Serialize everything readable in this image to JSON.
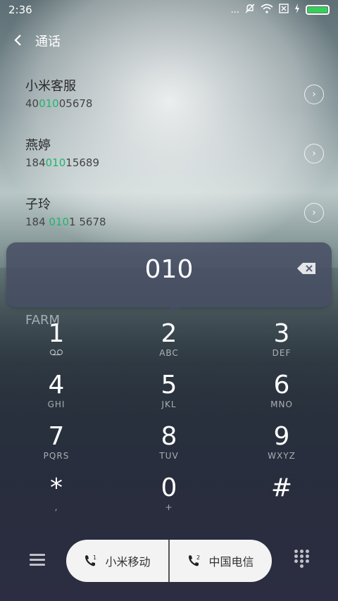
{
  "status": {
    "time": "2:36",
    "dots": "..."
  },
  "header": {
    "title": "通话"
  },
  "contacts": [
    {
      "name": "小米客服",
      "num_pre": "40",
      "num_hl": "010",
      "num_post": "05678"
    },
    {
      "name": "燕婷",
      "num_pre": "184",
      "num_hl": "010",
      "num_post": "15689"
    },
    {
      "name": "子玲",
      "num_pre": "184 ",
      "num_hl": "010",
      "num_post": "1 5678"
    }
  ],
  "dial": {
    "number": "010"
  },
  "peek_text": "FARM",
  "keypad": [
    {
      "digit": "1",
      "sub": "⁣"
    },
    {
      "digit": "2",
      "sub": "ABC"
    },
    {
      "digit": "3",
      "sub": "DEF"
    },
    {
      "digit": "4",
      "sub": "GHI"
    },
    {
      "digit": "5",
      "sub": "JKL"
    },
    {
      "digit": "6",
      "sub": "MNO"
    },
    {
      "digit": "7",
      "sub": "PQRS"
    },
    {
      "digit": "8",
      "sub": "TUV"
    },
    {
      "digit": "9",
      "sub": "WXYZ"
    },
    {
      "digit": "*",
      "sub": ","
    },
    {
      "digit": "0",
      "sub": "+"
    },
    {
      "digit": "#",
      "sub": ""
    }
  ],
  "sim": {
    "sim1_label": "小米移动",
    "sim2_label": "中国电信"
  },
  "colors": {
    "highlight": "#1fb56e",
    "battery": "#34d058"
  }
}
